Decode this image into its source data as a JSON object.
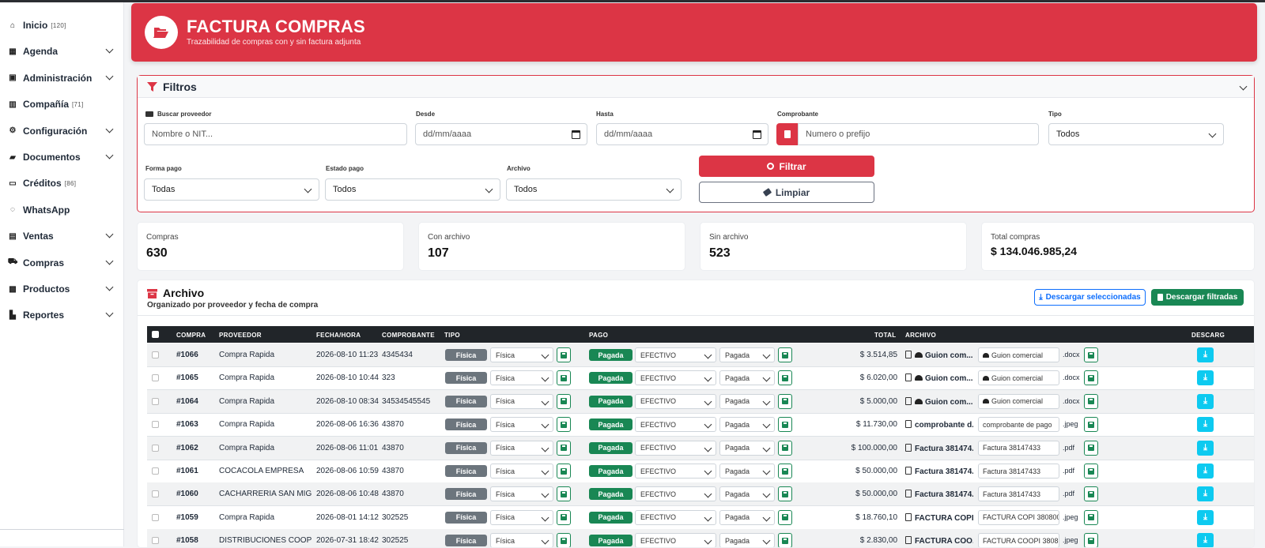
{
  "sidebar": {
    "items": [
      {
        "label": "Inicio",
        "badge": "[120]",
        "icon": "home-icon",
        "chevron": false
      },
      {
        "label": "Agenda",
        "badge": "",
        "icon": "calendar-icon",
        "chevron": true
      },
      {
        "label": "Administración",
        "badge": "",
        "icon": "id-card-icon",
        "chevron": true
      },
      {
        "label": "Compañía",
        "badge": "[71]",
        "icon": "building-icon",
        "chevron": false
      },
      {
        "label": "Configuración",
        "badge": "",
        "icon": "gears-icon",
        "chevron": true
      },
      {
        "label": "Documentos",
        "badge": "",
        "icon": "folder-icon",
        "chevron": true
      },
      {
        "label": "Créditos",
        "badge": "[86]",
        "icon": "credit-card-icon",
        "chevron": false
      },
      {
        "label": "WhatsApp",
        "badge": "",
        "icon": "whatsapp-icon",
        "chevron": false
      },
      {
        "label": "Ventas",
        "badge": "",
        "icon": "cash-register-icon",
        "chevron": true
      },
      {
        "label": "Compras",
        "badge": "",
        "icon": "cart-icon",
        "chevron": true
      },
      {
        "label": "Productos",
        "badge": "",
        "icon": "boxes-icon",
        "chevron": true
      },
      {
        "label": "Reportes",
        "badge": "",
        "icon": "chart-icon",
        "chevron": true
      }
    ]
  },
  "header": {
    "title": "FACTURA COMPRAS",
    "subtitle": "Trazabilidad de compras con y sin factura adjunta"
  },
  "filters": {
    "title": "Filtros",
    "proveedor_label": "Buscar proveedor",
    "proveedor_placeholder": "Nombre o NIT...",
    "desde_label": "Desde",
    "desde_value": "dd/mm/aaaa",
    "hasta_label": "Hasta",
    "hasta_value": "dd/mm/aaaa",
    "comprobante_label": "Comprobante",
    "comprobante_placeholder": "Numero o prefijo",
    "tipo_label": "Tipo",
    "tipo_value": "Todos",
    "forma_label": "Forma pago",
    "forma_value": "Todas",
    "estado_label": "Estado pago",
    "estado_value": "Todos",
    "archivo_label": "Archivo",
    "archivo_value": "Todos",
    "filtrar_button": "Filtrar",
    "limpiar_button": "Limpiar"
  },
  "stats": [
    {
      "label": "Compras",
      "value": "630"
    },
    {
      "label": "Con archivo",
      "value": "107"
    },
    {
      "label": "Sin archivo",
      "value": "523"
    },
    {
      "label": "Total compras",
      "value": "$ 134.046.985,24"
    }
  ],
  "archive": {
    "title": "Archivo",
    "subtitle": "Organizado por proveedor y fecha de compra",
    "download_selected": "Descargar seleccionadas",
    "download_filtered": "Descargar filtradas"
  },
  "table": {
    "headers": {
      "compra": "COMPRA",
      "proveedor": "PROVEEDOR",
      "fecha": "FECHA/HORA",
      "comprobante": "COMPROBANTE",
      "tipo": "TIPO",
      "pago": "PAGO",
      "total": "TOTAL",
      "archivo": "ARCHIVO",
      "descarga": "DESCARG"
    },
    "rows": [
      {
        "compra": "#1066",
        "proveedor": "Compra Rapida",
        "fecha": "2026-08-10 11:23",
        "comprobante": "4345434",
        "tipo": "Física",
        "tipo_sel": "Física",
        "pago": "Pagada",
        "forma": "EFECTIVO",
        "estado": "Pagada",
        "total": "$ 3.514,85",
        "archivo": "Guion com...",
        "archivo_icon": "hat",
        "archivo_input": "Guion comercial",
        "ext": ".docx"
      },
      {
        "compra": "#1065",
        "proveedor": "Compra Rapida",
        "fecha": "2026-08-10 10:44",
        "comprobante": "323",
        "tipo": "Física",
        "tipo_sel": "Física",
        "pago": "Pagada",
        "forma": "EFECTIVO",
        "estado": "Pagada",
        "total": "$ 6.020,00",
        "archivo": "Guion com...",
        "archivo_icon": "hat",
        "archivo_input": "Guion comercial",
        "ext": ".docx"
      },
      {
        "compra": "#1064",
        "proveedor": "Compra Rapida",
        "fecha": "2026-08-10 08:34",
        "comprobante": "34534545545",
        "tipo": "Física",
        "tipo_sel": "Física",
        "pago": "Pagada",
        "forma": "EFECTIVO",
        "estado": "Pagada",
        "total": "$ 5.000,00",
        "archivo": "Guion com...",
        "archivo_icon": "hat",
        "archivo_input": "Guion comercial",
        "ext": ".docx"
      },
      {
        "compra": "#1063",
        "proveedor": "Compra Rapida",
        "fecha": "2026-08-06 16:36",
        "comprobante": "43870",
        "tipo": "Física",
        "tipo_sel": "Física",
        "pago": "Pagada",
        "forma": "EFECTIVO",
        "estado": "Pagada",
        "total": "$ 11.730,00",
        "archivo": "comprobante d...",
        "archivo_icon": "",
        "archivo_input": "comprobante de pago",
        "ext": ".jpeg"
      },
      {
        "compra": "#1062",
        "proveedor": "Compra Rapida",
        "fecha": "2026-08-06 11:01",
        "comprobante": "43870",
        "tipo": "Física",
        "tipo_sel": "Física",
        "pago": "Pagada",
        "forma": "EFECTIVO",
        "estado": "Pagada",
        "total": "$ 100.000,00",
        "archivo": "Factura 381474...",
        "archivo_icon": "",
        "archivo_input": "Factura 38147433",
        "ext": ".pdf"
      },
      {
        "compra": "#1061",
        "proveedor": "COCACOLA EMPRESA",
        "fecha": "2026-08-06 10:59",
        "comprobante": "43870",
        "tipo": "Física",
        "tipo_sel": "Física",
        "pago": "Pagada",
        "forma": "EFECTIVO",
        "estado": "Pagada",
        "total": "$ 50.000,00",
        "archivo": "Factura 381474...",
        "archivo_icon": "",
        "archivo_input": "Factura 38147433",
        "ext": ".pdf"
      },
      {
        "compra": "#1060",
        "proveedor": "CACHARRERIA SAN MIG...",
        "fecha": "2026-08-06 10:48",
        "comprobante": "43870",
        "tipo": "Física",
        "tipo_sel": "Física",
        "pago": "Pagada",
        "forma": "EFECTIVO",
        "estado": "Pagada",
        "total": "$ 50.000,00",
        "archivo": "Factura 381474...",
        "archivo_icon": "",
        "archivo_input": "Factura 38147433",
        "ext": ".pdf"
      },
      {
        "compra": "#1059",
        "proveedor": "Compra Rapida",
        "fecha": "2026-08-01 14:12",
        "comprobante": "302525",
        "tipo": "Física",
        "tipo_sel": "Física",
        "pago": "Pagada",
        "forma": "EFECTIVO",
        "estado": "Pagada",
        "total": "$ 18.760,10",
        "archivo": "FACTURA COPI...",
        "archivo_icon": "",
        "archivo_input": "FACTURA COPI 380800",
        "ext": ".jpeg"
      },
      {
        "compra": "#1058",
        "proveedor": "DISTRIBUCIONES COOPI...",
        "fecha": "2026-07-31 18:42",
        "comprobante": "302525",
        "tipo": "Física",
        "tipo_sel": "Física",
        "pago": "Pagada",
        "forma": "EFECTIVO",
        "estado": "Pagada",
        "total": "$ 2.830,00",
        "archivo": "FACTURA COO...",
        "archivo_icon": "",
        "archivo_input": "FACTURA COOPI 38086",
        "ext": ".jpeg"
      }
    ]
  },
  "colors": {
    "brand_red": "#dc3545",
    "success": "#198754",
    "secondary": "#6c757d",
    "info": "#0dcaf0",
    "primary": "#0d6efd",
    "dark": "#212529"
  }
}
